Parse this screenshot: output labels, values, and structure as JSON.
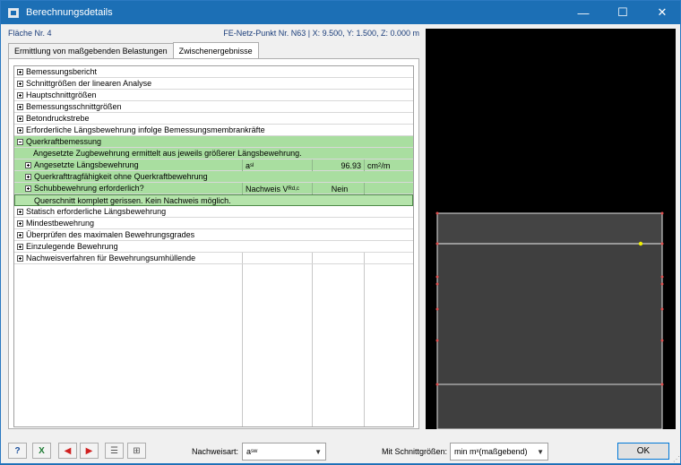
{
  "window": {
    "title": "Berechnungsdetails",
    "minimize": "—",
    "maximize": "☐",
    "close": "✕"
  },
  "info": {
    "left": "Fläche Nr. 4",
    "right": "FE-Netz-Punkt Nr. N63  |  X: 9.500, Y: 1.500, Z: 0.000 m"
  },
  "tabs": [
    {
      "label": "Ermittlung von maßgebenden Belastungen"
    },
    {
      "label": "Zwischenergebnisse"
    }
  ],
  "tree": {
    "rows": [
      {
        "label": "Bemessungsbericht"
      },
      {
        "label": "Schnittgrößen der linearen Analyse"
      },
      {
        "label": "Hauptschnittgrößen"
      },
      {
        "label": "Bemessungsschnittgrößen"
      },
      {
        "label": "Betondruckstrebe"
      },
      {
        "label": "Erforderliche Längsbewehrung infolge Bemessungsmembrankräfte"
      },
      {
        "label": "Querkraftbemessung"
      },
      {
        "label": "Angesetzte Zugbewehrung ermittelt aus jeweils größerer Längsbewehrung."
      },
      {
        "label": "Angesetzte Längsbewehrung",
        "symbol": "a",
        "symbol_sub": "sl",
        "value": "96.93",
        "unit": "cm",
        "unit_sup": "2",
        "unit_tail": "/m"
      },
      {
        "label": "Querkrafttragfähigkeit ohne Querkraftbewehrung"
      },
      {
        "label": "Schubbewehrung erforderlich?",
        "symbol": "Nachweis V",
        "symbol_sub": "Rd,c",
        "value": "Nein"
      },
      {
        "label": "Querschnitt komplett gerissen. Kein Nachweis möglich."
      },
      {
        "label": "Statisch erforderliche Längsbewehrung"
      },
      {
        "label": "Mindestbewehrung"
      },
      {
        "label": "Überprüfen des maximalen Bewehrungsgrades"
      },
      {
        "label": "Einzulegende Bewehrung"
      },
      {
        "label": "Nachweisverfahren für Bewehrungsumhüllende"
      }
    ]
  },
  "bottom": {
    "nachweisart_label": "Nachweisart:",
    "nachweisart_value": "a",
    "nachweisart_sub": "sw",
    "schnitt_label": "Mit Schnittgrößen:",
    "schnitt_value_a": "min m",
    "schnitt_value_sub": "x",
    "schnitt_value_b": " (maßgebend)",
    "ok_label": "OK"
  },
  "colors": {
    "title_bar": "#1c6fb5",
    "highlight_green": "#a9dea0",
    "graphic_bg": "#000000",
    "section_fill": "#3f3f3f"
  }
}
